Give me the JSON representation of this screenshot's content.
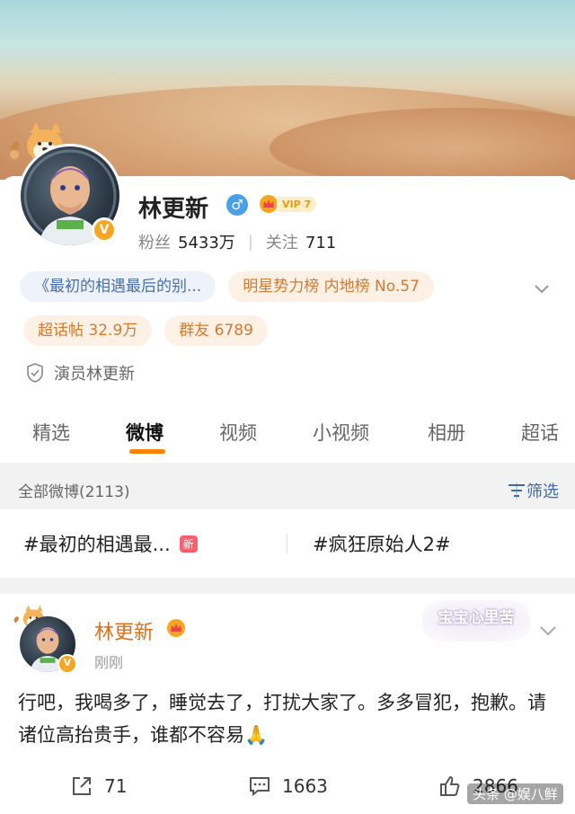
{
  "profile": {
    "name": "林更新",
    "gender_symbol": "♂",
    "vip_level": "VIP 7",
    "fans_label": "粉丝",
    "fans_value": "5433万",
    "follow_label": "关注",
    "follow_value": "711",
    "verify_badge": "V"
  },
  "chips": {
    "drama": "《最初的相遇最后的别...",
    "rank": "明星势力榜 内地榜 No.57",
    "super_topic": "超话帖 32.9万",
    "group": "群友 6789"
  },
  "verification": "演员林更新",
  "tabs": [
    "精选",
    "微博",
    "视频",
    "小视频",
    "相册",
    "超话"
  ],
  "active_tab": "微博",
  "feed": {
    "all_posts": "全部微博(2113)",
    "filter": "筛选"
  },
  "topics": {
    "left": "#最初的相遇最...",
    "new_badge": "新",
    "right": "#疯狂原始人2#"
  },
  "post": {
    "author": "林更新",
    "time": "刚刚",
    "sticker_text": "宝宝心里苦",
    "text": "行吧，我喝多了，睡觉去了，打扰大家了。多多冒犯，抱歉。请诸位高抬贵手，谁都不容易🙏",
    "reposts": "71",
    "comments": "1663",
    "likes": "2866"
  },
  "watermark": "头条 @娱八鲜",
  "colors": {
    "accent_orange": "#ff8200",
    "link_blue": "#3c6ba8",
    "vip_gold": "#f6a623",
    "author_orange": "#e06e1a"
  }
}
